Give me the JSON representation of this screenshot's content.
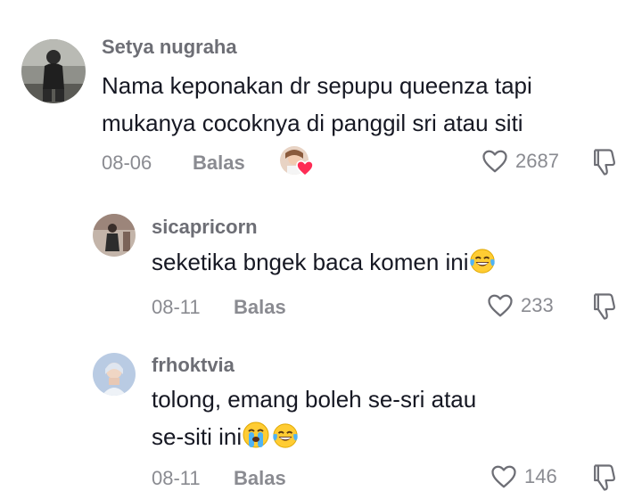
{
  "comments": [
    {
      "username": "Setya nugraha",
      "text_line1": "Nama keponakan dr sepupu queenza tapi",
      "text_line2": "mukanya cocoknya di panggil sri atau siti",
      "date": "08-06",
      "reply_label": "Balas",
      "likes": "2687"
    },
    {
      "username": "sicapricorn",
      "text_line1": "seketika bngek baca komen ini",
      "date": "08-11",
      "reply_label": "Balas",
      "likes": "233"
    },
    {
      "username": "frhoktvia",
      "text_line1": "tolong, emang boleh se-sri atau",
      "text_line2": "se-siti ini",
      "date": "08-11",
      "reply_label": "Balas",
      "likes": "146"
    }
  ],
  "icons": {
    "like": "heart-outline-icon",
    "dislike": "thumbs-down-icon",
    "creator_liked": "creator-liked-heart-icon",
    "emoji_laugh": "face-with-tears-of-joy-icon",
    "emoji_cry": "loudly-crying-face-icon"
  },
  "colors": {
    "username": "#6d6e75",
    "meta": "#8a8b91",
    "text": "#161823",
    "heart_badge": "#fe2c55"
  }
}
